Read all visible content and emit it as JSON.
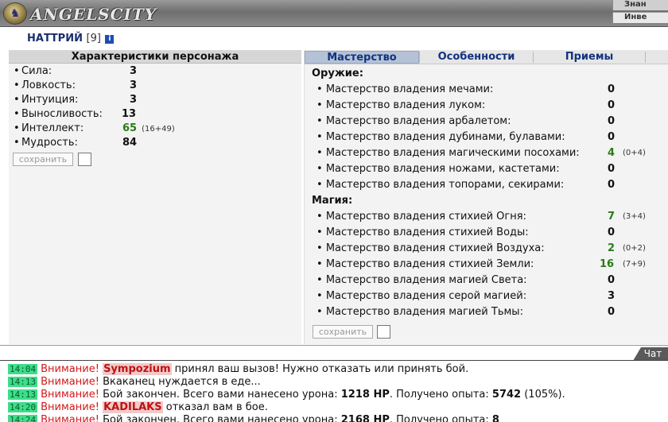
{
  "header": {
    "logo_text": "ANGELSCITY",
    "right_row1": "Знан",
    "right_row2": "Инве"
  },
  "character": {
    "name": "НАТТРИЙ",
    "level": "[9]",
    "info_icon": "i"
  },
  "stats_panel": {
    "title": "Характеристики персонажа",
    "stats": [
      {
        "label": "Сила:",
        "value": "3",
        "extra": ""
      },
      {
        "label": "Ловкость:",
        "value": "3",
        "extra": ""
      },
      {
        "label": "Интуиция:",
        "value": "3",
        "extra": ""
      },
      {
        "label": "Выносливость:",
        "value": "13",
        "extra": ""
      },
      {
        "label": "Интеллект:",
        "value": "65",
        "extra": "(16+49)"
      },
      {
        "label": "Мудрость:",
        "value": "84",
        "extra": ""
      }
    ],
    "save_label": "сохранить"
  },
  "skills_panel": {
    "tabs": [
      "Мастерство",
      "Особенности",
      "Приемы"
    ],
    "weapons_title": "Оружие:",
    "weapons": [
      {
        "label": "Мастерство владения мечами:",
        "value": "0",
        "extra": ""
      },
      {
        "label": "Мастерство владения луком:",
        "value": "0",
        "extra": ""
      },
      {
        "label": "Мастерство владения арбалетом:",
        "value": "0",
        "extra": ""
      },
      {
        "label": "Мастерство владения дубинами, булавами:",
        "value": "0",
        "extra": ""
      },
      {
        "label": "Мастерство владения магическими посохами:",
        "value": "4",
        "extra": "(0+4)"
      },
      {
        "label": "Мастерство владения ножами, кастетами:",
        "value": "0",
        "extra": ""
      },
      {
        "label": "Мастерство владения топорами, секирами:",
        "value": "0",
        "extra": ""
      }
    ],
    "magic_title": "Магия:",
    "magic": [
      {
        "label": "Мастерство владения стихией Огня:",
        "value": "7",
        "extra": "(3+4)"
      },
      {
        "label": "Мастерство владения стихией Воды:",
        "value": "0",
        "extra": ""
      },
      {
        "label": "Мастерство владения стихией Воздуха:",
        "value": "2",
        "extra": "(0+2)"
      },
      {
        "label": "Мастерство владения стихией Земли:",
        "value": "16",
        "extra": "(7+9)"
      },
      {
        "label": "Мастерство владения магией Света:",
        "value": "0",
        "extra": ""
      },
      {
        "label": "Мастерство владения серой магией:",
        "value": "3",
        "extra": ""
      },
      {
        "label": "Мастерство владения магией Тьмы:",
        "value": "0",
        "extra": ""
      }
    ],
    "save_label": "сохранить"
  },
  "chat": {
    "tab_label": "Чат",
    "messages": [
      {
        "time": "14:04",
        "warn": "Внимание!",
        "nick": "Sympozium",
        "text": "принял ваш вызов! Нужно отказать или принять бой."
      },
      {
        "time": "14:13",
        "warn": "Внимание!",
        "nick": "",
        "text": "Вкаканец нуждается в еде..."
      },
      {
        "time": "14:13",
        "warn": "Внимание!",
        "nick": "",
        "text": "Бой закончен. Всего вами нанесено урона:",
        "hp": "1218 HP",
        "text2": ". Получено опыта:",
        "exp": "5742",
        "text3": "(105%)."
      },
      {
        "time": "14:20",
        "warn": "Внимание!",
        "nick": "KADILAKS",
        "text": "отказал вам в бое."
      },
      {
        "time": "14:24",
        "warn": "Внимание!",
        "nick": "",
        "text": "Бой закончен. Всего вами нанесено урона:",
        "hp": "2168 HP",
        "text2": ". Получено опыта:",
        "exp": "8",
        "text3": ""
      }
    ]
  }
}
